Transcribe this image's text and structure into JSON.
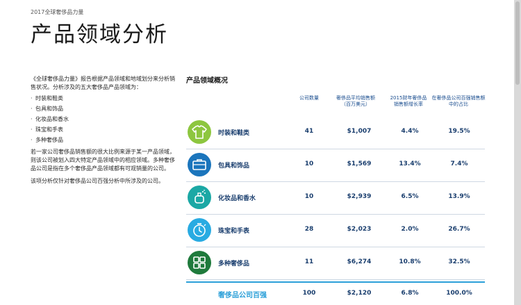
{
  "header": {
    "kicker": "2017全球奢侈品力量",
    "title": "产品领域分析"
  },
  "intro": {
    "para1": "《全球奢侈品力量》报告根据产品领域和地域划分来分析销售状况。分析涉及的五大奢侈品产品领域为：",
    "bullets": [
      "时装和鞋类",
      "包具和饰品",
      "化妆品和香水",
      "珠宝和手表",
      "多种奢侈品"
    ],
    "para2": "若一家公司奢侈品销售额的很大比例来源于某一产品领域，则该公司被划入四大特定产品领域中的相应领域。多种奢侈品公司是指在多个奢侈品产品领域都有可观销量的公司。",
    "para3": "该项分析仅针对奢侈品公司百强分析中所涉及的公司。"
  },
  "table": {
    "title": "产品领域概况",
    "headers": {
      "count": "公司数量",
      "avg_sales": "奢侈品平均销售额\n（百万美元）",
      "growth": "2015财年奢侈品\n销售额增长率",
      "share": "在奢侈品公司百强销售额\n中的占比"
    },
    "rows": [
      {
        "icon": "shirt-icon",
        "color": "#8dc63f",
        "label": "时装和鞋类",
        "count": "41",
        "avg": "$1,007",
        "growth": "4.4%",
        "share": "19.5%"
      },
      {
        "icon": "briefcase-icon",
        "color": "#1b75bc",
        "label": "包具和饰品",
        "count": "10",
        "avg": "$1,569",
        "growth": "13.4%",
        "share": "7.4%"
      },
      {
        "icon": "perfume-icon",
        "color": "#1ba8a5",
        "label": "化妆品和香水",
        "count": "10",
        "avg": "$2,939",
        "growth": "6.5%",
        "share": "13.9%"
      },
      {
        "icon": "watch-icon",
        "color": "#29abe2",
        "label": "珠宝和手表",
        "count": "28",
        "avg": "$2,023",
        "growth": "2.0%",
        "share": "26.7%"
      },
      {
        "icon": "grid-icon",
        "color": "#1f7a3c",
        "label": "多种奢侈品",
        "count": "11",
        "avg": "$6,274",
        "growth": "10.8%",
        "share": "32.5%"
      }
    ],
    "total": {
      "label": "奢侈品公司百强",
      "count": "100",
      "avg": "$2,120",
      "growth": "6.8%",
      "share": "100.0%"
    }
  }
}
